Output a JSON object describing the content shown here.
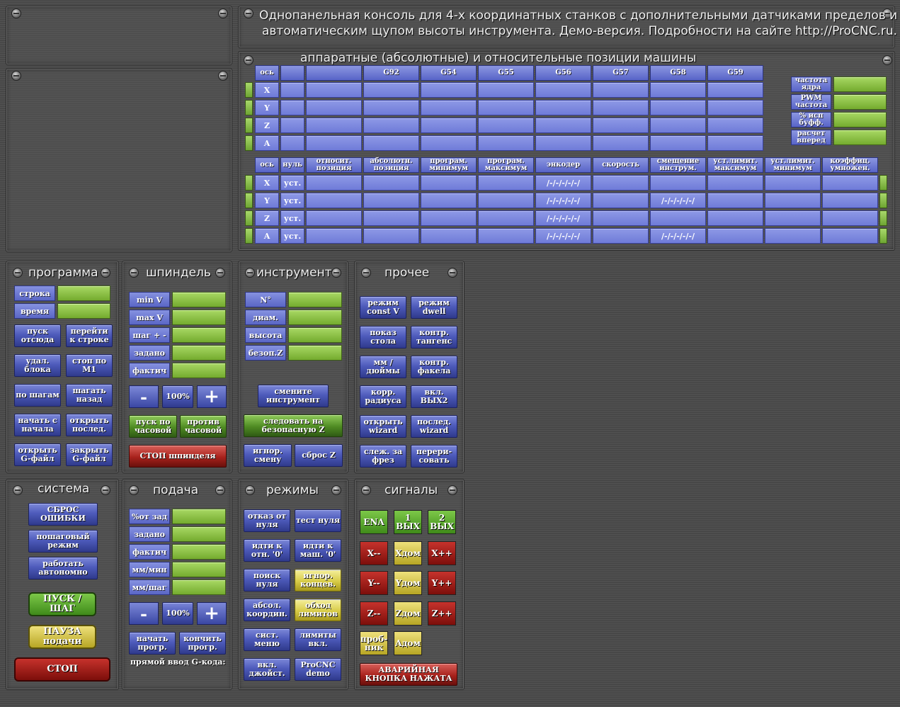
{
  "header": {
    "line1": "Однопанельная консоль для 4-х координатных станков с дополнительными датчиками пределов и",
    "line2": "автоматическим щупом высоты инструмента. Демо-версия. Подробности на сайте http://ProCNC.ru."
  },
  "positions": {
    "title": "аппаратные (абсолютные) и относительные позиции машины",
    "top_headers": [
      "ось",
      "",
      "",
      "G92",
      "G54",
      "G55",
      "G56",
      "G57",
      "G58",
      "G59"
    ],
    "axes": [
      "X",
      "Y",
      "Z",
      "A"
    ],
    "right_labels": [
      "частота ядра",
      "PWM частота",
      "% исп буфф.",
      "расчет вперед"
    ],
    "bottom_headers": [
      "ось",
      "нуль",
      "относит. позиция",
      "абсолютн. позиция",
      "програм. минимум",
      "програм. максимум",
      "энкодер",
      "скорость",
      "смещение инструм.",
      "уст.лимит. максимум",
      "уст.лимит. минимум",
      "коэффиц. умножен."
    ],
    "zero_label": "уст.",
    "encoder_values": [
      "/-/-/-/-/-/",
      "/-/-/-/-/-/",
      "/-/-/-/-/-/",
      "/-/-/-/-/-/"
    ],
    "offset_values": [
      "",
      "/-/-/-/-/-/",
      "",
      "/-/-/-/-/-/"
    ]
  },
  "program": {
    "title": "программа",
    "fields": [
      "строка",
      "время"
    ],
    "buttons": [
      [
        "пуск отсюда",
        "перейти к строке"
      ],
      [
        "удал. блока",
        "стоп по M1"
      ],
      [
        "по шагам",
        "шагать назад"
      ],
      [
        "начать с начала",
        "открыть послед."
      ],
      [
        "открыть G-файл",
        "закрыть G-файл"
      ]
    ]
  },
  "spindle": {
    "title": "шпиндель",
    "fields": [
      "min V",
      "max V",
      "шаг + -",
      "задано",
      "фактич"
    ],
    "minus": "-",
    "percent": "100%",
    "plus": "+",
    "cw": "пуск по часовой",
    "ccw": "против часовой",
    "stop": "СТОП шпинделя"
  },
  "tool": {
    "title": "инструмент",
    "fields": [
      "N°",
      "диам.",
      "высота",
      "безоп.Z"
    ],
    "change": "смените инструмент",
    "follow": "следовать на безопасную Z",
    "ignore": "игнор. смену",
    "resetz": "сброс Z"
  },
  "misc": {
    "title": "прочее",
    "buttons": [
      [
        "режим const V",
        "режим dwell"
      ],
      [
        "показ стола",
        "контр. тангенс"
      ],
      [
        "мм / дюймы",
        "контр. факела"
      ],
      [
        "корр. радиуса",
        "вкл. ВЫХ2"
      ],
      [
        "открыть wizard",
        "послед. wizard"
      ],
      [
        "слеж. за фрез",
        "перери-совать"
      ]
    ]
  },
  "system": {
    "title": "система",
    "reset": "СБРОС ОШИБКИ",
    "step": "пошаговый режим",
    "auto": "работать автономно",
    "start": "ПУСК / ШАГ",
    "pause": "ПАУЗА подачи",
    "stop": "СТОП"
  },
  "feed": {
    "title": "подача",
    "fields": [
      "%от зад",
      "задано",
      "фактич",
      "мм/мин",
      "мм/шаг"
    ],
    "minus": "-",
    "percent": "100%",
    "plus": "+",
    "begin": "начать прогр.",
    "end": "кончить прогр.",
    "mdi": "прямой ввод G-кода:"
  },
  "modes": {
    "title": "режимы",
    "buttons": [
      [
        "отказ от нуля",
        "тест нуля"
      ],
      [
        "идти к отн. '0'",
        "идти к маш. '0'"
      ],
      [
        "поиск нуля",
        "игнор. концев."
      ],
      [
        "абсол. координ.",
        "обход лимитов"
      ],
      [
        "сист. меню",
        "лимиты вкл."
      ],
      [
        "вкл. джойст.",
        "ProCNC demo"
      ]
    ]
  },
  "signals": {
    "title": "сигналы",
    "row1": [
      "ENA",
      "1 ВЫХ",
      "2 ВЫХ"
    ],
    "row2": [
      "X--",
      "Xдом",
      "X++"
    ],
    "row3": [
      "Y--",
      "Yдом",
      "Y++"
    ],
    "row4": [
      "Z--",
      "Zдом",
      "Z++"
    ],
    "row5": [
      "проб-ник",
      "Aдом"
    ],
    "estop": "АВАРИЙНАЯ КНОПКА НАЖАТА"
  }
}
